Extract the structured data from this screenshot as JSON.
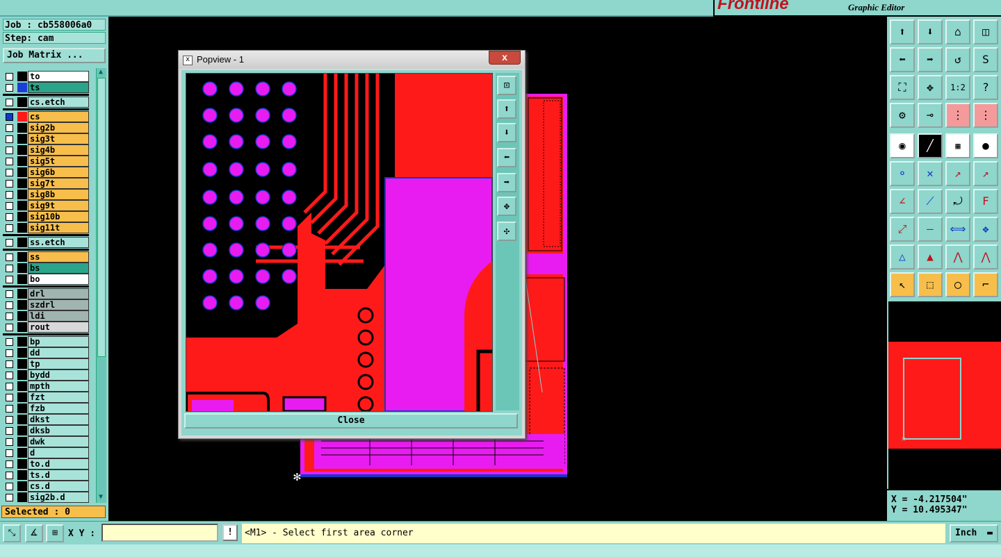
{
  "header": {
    "brand": "Frontline",
    "subtitle": "Graphic Editor"
  },
  "left": {
    "job": "Job : cb558006a0",
    "step": "Step: cam",
    "job_matrix": "Job Matrix ...",
    "selected": "Selected : 0",
    "layers": [
      {
        "name": "to",
        "color": "#ffffff",
        "swatch": "#000000",
        "sep": false
      },
      {
        "name": "ts",
        "color": "#2aa58a",
        "swatch": "#1b3fd6",
        "sep": false
      },
      {
        "name": "cs.etch",
        "color": "#a8e3da",
        "swatch": "#000000",
        "sep": true
      },
      {
        "name": "cs",
        "color": "#f7be4b",
        "swatch": "#ff1a1a",
        "sep": true,
        "checked": true
      },
      {
        "name": "sig2b",
        "color": "#f7be4b",
        "swatch": "#000000",
        "sep": false
      },
      {
        "name": "sig3t",
        "color": "#f7be4b",
        "swatch": "#000000",
        "sep": false
      },
      {
        "name": "sig4b",
        "color": "#f7be4b",
        "swatch": "#000000",
        "sep": false
      },
      {
        "name": "sig5t",
        "color": "#f7be4b",
        "swatch": "#000000",
        "sep": false
      },
      {
        "name": "sig6b",
        "color": "#f7be4b",
        "swatch": "#000000",
        "sep": false
      },
      {
        "name": "sig7t",
        "color": "#f7be4b",
        "swatch": "#000000",
        "sep": false
      },
      {
        "name": "sig8b",
        "color": "#f7be4b",
        "swatch": "#000000",
        "sep": false
      },
      {
        "name": "sig9t",
        "color": "#f7be4b",
        "swatch": "#000000",
        "sep": false
      },
      {
        "name": "sig10b",
        "color": "#f7be4b",
        "swatch": "#000000",
        "sep": false
      },
      {
        "name": "sig11t",
        "color": "#f7be4b",
        "swatch": "#000000",
        "sep": false
      },
      {
        "name": "ss.etch",
        "color": "#a8e3da",
        "swatch": "#000000",
        "sep": true
      },
      {
        "name": "ss",
        "color": "#f7be4b",
        "swatch": "#000000",
        "sep": true
      },
      {
        "name": "bs",
        "color": "#2aa58a",
        "swatch": "#000000",
        "sep": false
      },
      {
        "name": "bo",
        "color": "#ffffff",
        "swatch": "#000000",
        "sep": false
      },
      {
        "name": "drl",
        "color": "#a0b4b0",
        "swatch": "#000000",
        "sep": true
      },
      {
        "name": "szdrl",
        "color": "#a0b4b0",
        "swatch": "#000000",
        "sep": false
      },
      {
        "name": "ldi",
        "color": "#a0b4b0",
        "swatch": "#000000",
        "sep": false
      },
      {
        "name": "rout",
        "color": "#d8d8d8",
        "swatch": "#000000",
        "sep": false
      },
      {
        "name": "bp",
        "color": "#a8e3da",
        "swatch": "#000000",
        "sep": true
      },
      {
        "name": "dd",
        "color": "#a8e3da",
        "swatch": "#000000",
        "sep": false
      },
      {
        "name": "tp",
        "color": "#a8e3da",
        "swatch": "#000000",
        "sep": false
      },
      {
        "name": "bydd",
        "color": "#a8e3da",
        "swatch": "#000000",
        "sep": false
      },
      {
        "name": "mpth",
        "color": "#a8e3da",
        "swatch": "#000000",
        "sep": false
      },
      {
        "name": "fzt",
        "color": "#a8e3da",
        "swatch": "#000000",
        "sep": false
      },
      {
        "name": "fzb",
        "color": "#a8e3da",
        "swatch": "#000000",
        "sep": false
      },
      {
        "name": "dkst",
        "color": "#a8e3da",
        "swatch": "#000000",
        "sep": false
      },
      {
        "name": "dksb",
        "color": "#a8e3da",
        "swatch": "#000000",
        "sep": false
      },
      {
        "name": "dwk",
        "color": "#a8e3da",
        "swatch": "#000000",
        "sep": false
      },
      {
        "name": "d",
        "color": "#a8e3da",
        "swatch": "#000000",
        "sep": false
      },
      {
        "name": "to.d",
        "color": "#a8e3da",
        "swatch": "#000000",
        "sep": false
      },
      {
        "name": "ts.d",
        "color": "#a8e3da",
        "swatch": "#000000",
        "sep": false
      },
      {
        "name": "cs.d",
        "color": "#a8e3da",
        "swatch": "#000000",
        "sep": false
      },
      {
        "name": "sig2b.d",
        "color": "#a8e3da",
        "swatch": "#000000",
        "sep": false
      }
    ]
  },
  "popview": {
    "title": "Popview - 1",
    "close_x": "x",
    "close_button": "Close"
  },
  "coords": {
    "x": "X = -4.217504\"",
    "y": "Y = 10.495347\""
  },
  "bottom": {
    "xy_label": "X Y :",
    "xy_value": "",
    "bang": "!",
    "prompt": "<M1> - Select first area corner",
    "units": "Inch"
  },
  "colors": {
    "panel": "#8fd6cc",
    "copper": "#ff1a1a",
    "mask": "#e81cf0",
    "signal_layer": "#f7be4b"
  }
}
